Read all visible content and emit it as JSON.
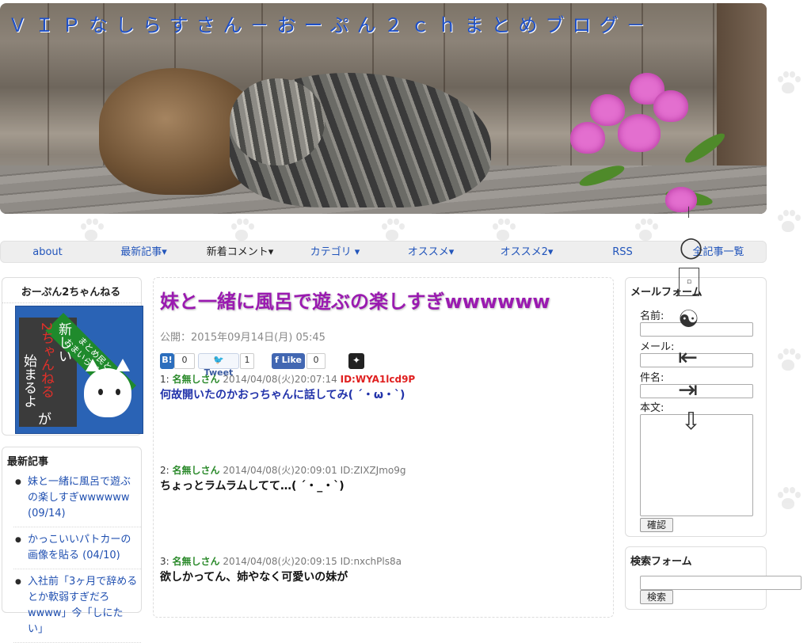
{
  "header": {
    "site_title": "ＶＩＰなしらすさん－おーぷん２ｃｈまとめブログ－"
  },
  "nav": {
    "items": [
      {
        "label": "about"
      },
      {
        "label": "最新記事▾"
      },
      {
        "label": "新着コメント▾"
      },
      {
        "label": "カテゴリ ▾"
      },
      {
        "label": "オススメ▾"
      },
      {
        "label": "オススメ2▾"
      },
      {
        "label": "RSS"
      },
      {
        "label": "全記事一覧"
      }
    ]
  },
  "left_sidebar": {
    "open2ch_box": {
      "title": "おーぷん2ちゃんねる",
      "banner": {
        "ribbon_line1": "まとめ民と",
        "ribbon_line2": "おまいらが作る",
        "line1": "新しい",
        "line2": "2ちゃんねる",
        "line3": "が",
        "line4": "始まるよ"
      }
    },
    "recent": {
      "title": "最新記事",
      "items": [
        {
          "text": "妹と一緒に風呂で遊ぶの楽しすぎwwwwww (09/14)"
        },
        {
          "text": "かっこいいパトカーの画像を貼る (04/10)"
        },
        {
          "text": "入社前「3ヶ月で辞めるとか軟弱すぎだろwwww」今「しにたい」"
        }
      ]
    }
  },
  "article": {
    "title": "妹と一緒に風呂で遊ぶの楽しすぎwwwwww",
    "published": "公開：2015年09月14日(月) 05:45",
    "share": {
      "hatena_label": "B!",
      "hatena_count": "0",
      "tweet_label": "Tweet",
      "tweet_count": "1",
      "like_label": "Like",
      "like_count": "0"
    },
    "posts": [
      {
        "num": "1:",
        "name": "名無しさん",
        "date": "2014/04/08(火)20:07:14",
        "id": "ID:WYA1lcd9P",
        "body": "何故開いたのかおっちゃんに話してみ( ´・ω・`)"
      },
      {
        "num": "2:",
        "name": "名無しさん",
        "date": "2014/04/08(火)20:09:01",
        "id": "ID:ZIXZJmo9g",
        "body": "ちょっとラムラムしてて…( ´・_・`)"
      },
      {
        "num": "3:",
        "name": "名無しさん",
        "date": "2014/04/08(火)20:09:15",
        "id": "ID:nxchPls8a",
        "body": "欲しかってん、姉やなく可愛いの妹が"
      }
    ]
  },
  "right_sidebar": {
    "mail_form": {
      "title": "メールフォーム",
      "name_label": "名前:",
      "mail_label": "メール:",
      "subject_label": "件名:",
      "body_label": "本文:",
      "submit": "確認"
    },
    "search_form": {
      "title": "検索フォーム",
      "submit": "検索"
    }
  }
}
